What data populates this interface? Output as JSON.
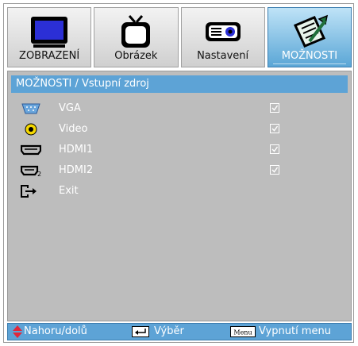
{
  "tabs": [
    {
      "label": "ZOBRAZENÍ",
      "icon": "display-icon"
    },
    {
      "label": "Obrázek",
      "icon": "tv-icon"
    },
    {
      "label": "Nastavení",
      "icon": "projector-icon"
    },
    {
      "label": "MOŽNOSTI",
      "icon": "notepad-icon",
      "active": true
    }
  ],
  "panel": {
    "title": "MOŽNOSTI / Vstupní zdroj",
    "items": [
      {
        "label": "VGA",
        "icon": "vga-port-icon",
        "checked": true
      },
      {
        "label": "Video",
        "icon": "video-rca-icon",
        "checked": true
      },
      {
        "label": "HDMI1",
        "icon": "hdmi-port-icon",
        "checked": true
      },
      {
        "label": "HDMI2",
        "icon": "hdmi2-port-icon",
        "checked": true
      },
      {
        "label": "Exit",
        "icon": "exit-icon"
      }
    ]
  },
  "footer": {
    "updown": "Nahoru/dolů",
    "enter": "Výběr",
    "menu_key": "Menu",
    "menu": "Vypnutí menu"
  },
  "colors": {
    "accent": "#5da3d6",
    "panel_bg": "#bdbdbd",
    "arrow": "#e0283c",
    "video_icon": "#f5d800"
  }
}
